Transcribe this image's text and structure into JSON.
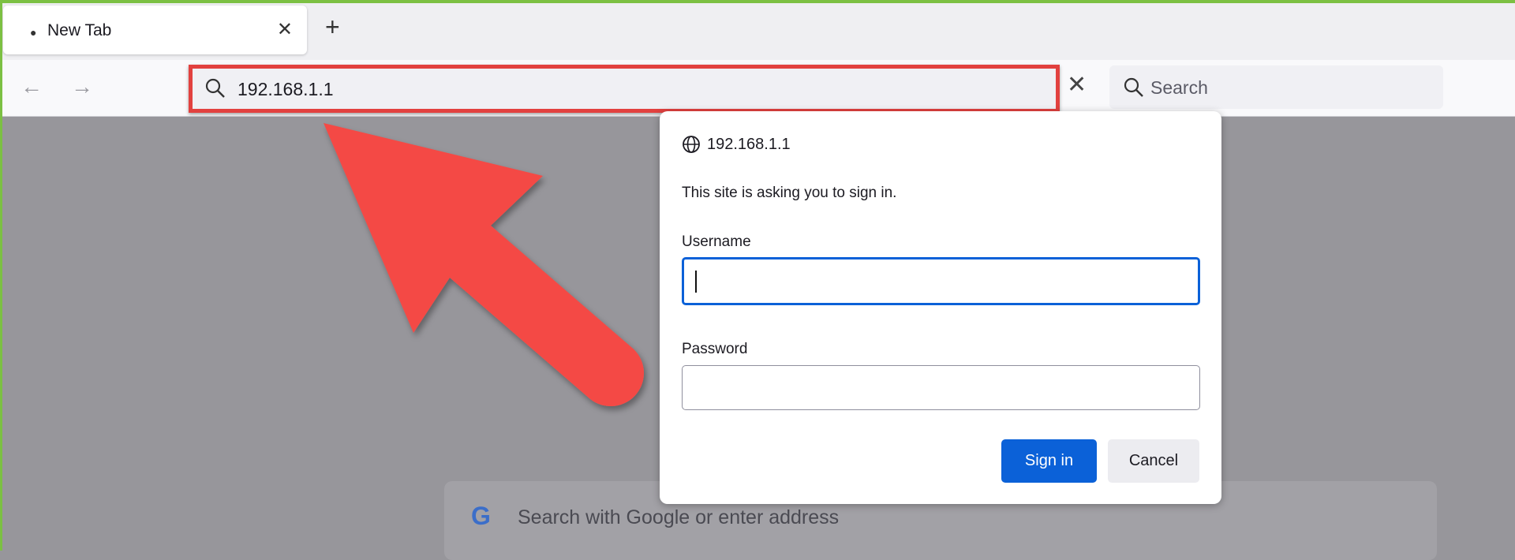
{
  "browser": {
    "tab": {
      "title": "New Tab",
      "close_icon": "close-icon"
    },
    "new_tab_label": "+",
    "url": "192.168.1.1",
    "search_placeholder": "Search",
    "newtab_search_placeholder": "Search with Google or enter address",
    "google_logo": "G"
  },
  "dialog": {
    "host": "192.168.1.1",
    "message": "This site is asking you to sign in.",
    "username_label": "Username",
    "username_value": "",
    "password_label": "Password",
    "password_value": "",
    "sign_in_label": "Sign in",
    "cancel_label": "Cancel"
  },
  "annotation": {
    "arrow_color": "#f44a45",
    "highlight_color": "#e2413f",
    "frame_color": "#7cc043"
  },
  "colors": {
    "accent": "#0b61d8"
  }
}
